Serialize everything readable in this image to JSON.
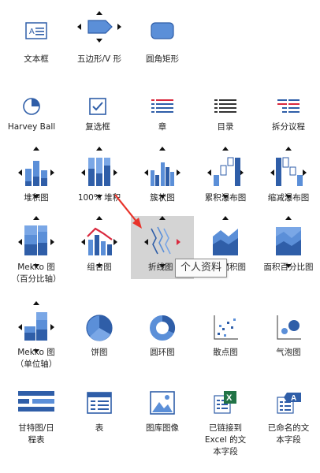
{
  "tiles": [
    {
      "key": "textbox",
      "label": "文本框"
    },
    {
      "key": "pentagon",
      "label": "五边形/V 形"
    },
    {
      "key": "rounded-rect",
      "label": "圆角矩形"
    },
    {
      "key": "harvey-ball",
      "label": "Harvey Ball"
    },
    {
      "key": "checkbox",
      "label": "复选框"
    },
    {
      "key": "chapter",
      "label": "章"
    },
    {
      "key": "toc",
      "label": "目录"
    },
    {
      "key": "split-agenda",
      "label": "拆分议程"
    },
    {
      "key": "stacked",
      "label": "堆积图"
    },
    {
      "key": "stacked-100",
      "label": "100% 堆积"
    },
    {
      "key": "clustered",
      "label": "簇状图"
    },
    {
      "key": "waterfall",
      "label": "累积瀑布图"
    },
    {
      "key": "reduce-waterfall",
      "label": "缩减瀑布图"
    },
    {
      "key": "mekko",
      "label": "Mekko 图（百分比轴）"
    },
    {
      "key": "combo",
      "label": "组合图"
    },
    {
      "key": "line",
      "label": "折线图"
    },
    {
      "key": "area",
      "label": "面积图"
    },
    {
      "key": "area-pct",
      "label": "面积百分比图"
    },
    {
      "key": "mekko-unit",
      "label": "Mekko 图（单位轴）"
    },
    {
      "key": "pie",
      "label": "饼图"
    },
    {
      "key": "doughnut",
      "label": "圆环图"
    },
    {
      "key": "scatter",
      "label": "散点图"
    },
    {
      "key": "bubble",
      "label": "气泡图"
    },
    {
      "key": "gantt",
      "label": "甘特图/日程表"
    },
    {
      "key": "table",
      "label": "表"
    },
    {
      "key": "library-image",
      "label": "图库图像"
    },
    {
      "key": "excel-linked",
      "label": "已链接到 Excel 的文本字段"
    },
    {
      "key": "named-text",
      "label": "已命名的文本字段"
    }
  ],
  "tooltip": "个人资料",
  "icons": {
    "textbox": "textbox-icon",
    "pentagon": "pentagon-icon",
    "rounded-rect": "rounded-rectangle-icon",
    "excel": "excel-icon"
  },
  "colors": {
    "accent": "#2f5ea8",
    "light": "#5b8fd8",
    "selected_bg": "#d4d4d4",
    "red_arrow": "#e8332a",
    "combo_line": "#d9283d"
  }
}
